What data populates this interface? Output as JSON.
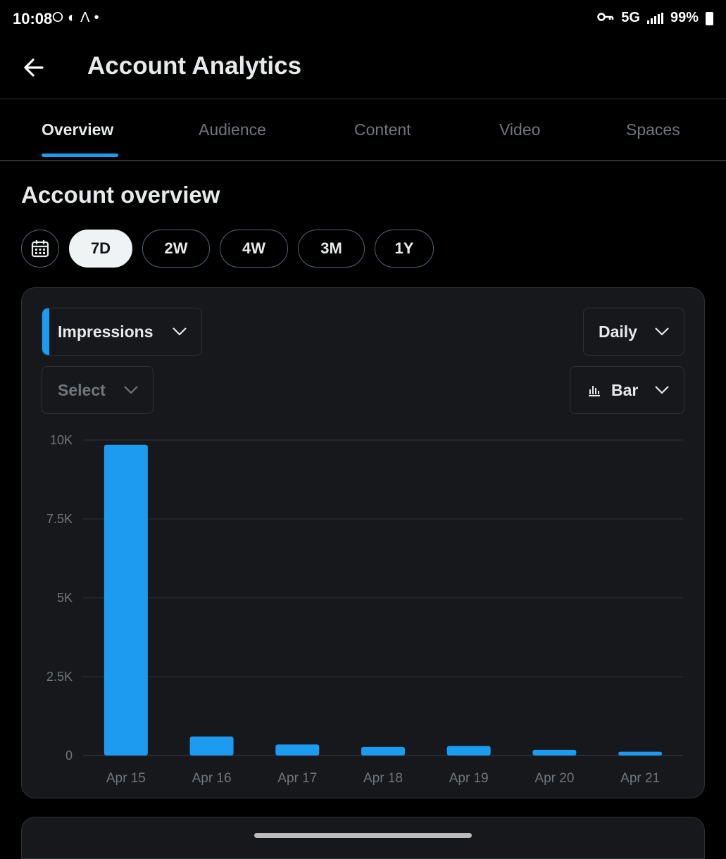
{
  "status_bar": {
    "time": "10:08",
    "notif_icons": [
      "playstation-icon",
      "discord-icon",
      "app-icon",
      "dot-icon"
    ],
    "network": "5G",
    "battery": "99%"
  },
  "header": {
    "title": "Account Analytics"
  },
  "tabs": [
    {
      "label": "Overview",
      "active": true
    },
    {
      "label": "Audience",
      "active": false
    },
    {
      "label": "Content",
      "active": false
    },
    {
      "label": "Video",
      "active": false
    },
    {
      "label": "Spaces",
      "active": false
    }
  ],
  "overview": {
    "title": "Account overview",
    "ranges": [
      {
        "label": "7D",
        "active": true
      },
      {
        "label": "2W",
        "active": false
      },
      {
        "label": "4W",
        "active": false
      },
      {
        "label": "3M",
        "active": false
      },
      {
        "label": "1Y",
        "active": false
      }
    ]
  },
  "controls": {
    "metric": "Impressions",
    "compare": "Select",
    "granularity": "Daily",
    "chart_type": "Bar"
  },
  "colors": {
    "accent": "#1d9bf0",
    "card_bg": "#16181c",
    "grid": "#2f3336",
    "muted": "#71767b"
  },
  "chart_data": {
    "type": "bar",
    "categories": [
      "Apr 15",
      "Apr 16",
      "Apr 17",
      "Apr 18",
      "Apr 19",
      "Apr 20",
      "Apr 21"
    ],
    "values": [
      9850,
      600,
      350,
      270,
      300,
      180,
      120
    ],
    "ylim": [
      0,
      10000
    ],
    "yticks": [
      0,
      2500,
      5000,
      7500,
      10000
    ],
    "ytick_labels": [
      "0",
      "2.5K",
      "5K",
      "7.5K",
      "10K"
    ],
    "grid": true,
    "color": "#1d9bf0"
  }
}
